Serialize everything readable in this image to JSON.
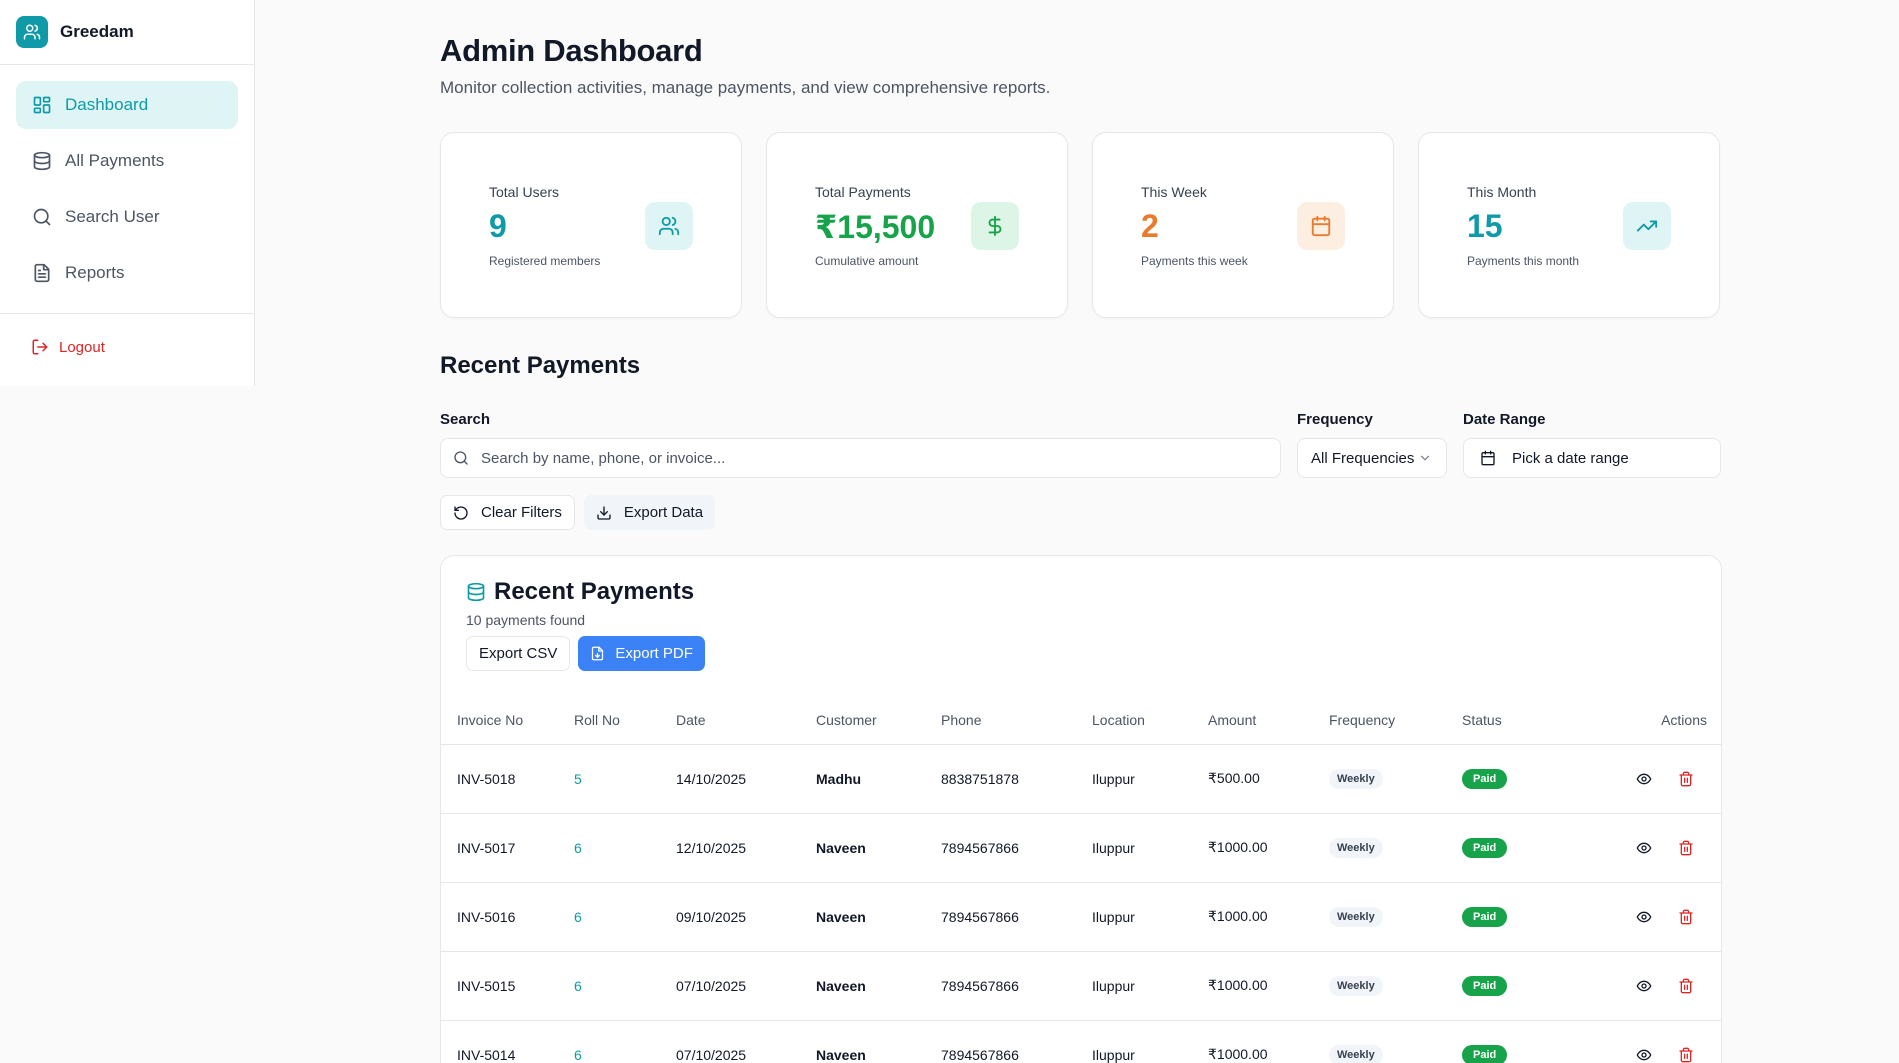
{
  "brand": {
    "name": "Greedam",
    "logo_icon": "users-icon"
  },
  "sidebar": {
    "items": [
      {
        "label": "Dashboard",
        "icon": "layout-dashboard-icon",
        "active": true
      },
      {
        "label": "All Payments",
        "icon": "database-icon",
        "active": false
      },
      {
        "label": "Search User",
        "icon": "search-icon",
        "active": false
      },
      {
        "label": "Reports",
        "icon": "file-text-icon",
        "active": false
      }
    ],
    "logout_label": "Logout"
  },
  "header": {
    "title": "Admin Dashboard",
    "subtitle": "Monitor collection activities, manage payments, and view comprehensive reports."
  },
  "stats": [
    {
      "label": "Total Users",
      "value": "9",
      "desc": "Registered members",
      "color": "#0e9aa7",
      "icon": "users-icon",
      "icon_bg": "#dff5f5"
    },
    {
      "label": "Total Payments",
      "value": "₹15,500",
      "desc": "Cumulative amount",
      "color": "#16a34a",
      "icon": "dollar-icon",
      "icon_bg": "#dcf5e6"
    },
    {
      "label": "This Week",
      "value": "2",
      "desc": "Payments this week",
      "color": "#ea7a2e",
      "icon": "calendar-icon",
      "icon_bg": "#fdeee2"
    },
    {
      "label": "This Month",
      "value": "15",
      "desc": "Payments this month",
      "color": "#0e9aa7",
      "icon": "trending-up-icon",
      "icon_bg": "#dff5f5"
    }
  ],
  "recent_section_title": "Recent Payments",
  "filters": {
    "search_label": "Search",
    "search_placeholder": "Search by name, phone, or invoice...",
    "frequency_label": "Frequency",
    "frequency_value": "All Frequencies",
    "date_label": "Date Range",
    "date_value": "Pick a date range",
    "clear_label": "Clear Filters",
    "export_label": "Export Data"
  },
  "table_card": {
    "title": "Recent Payments",
    "count_text": "10 payments found",
    "export_csv": "Export CSV",
    "export_pdf": "Export PDF",
    "columns": [
      "Invoice No",
      "Roll No",
      "Date",
      "Customer",
      "Phone",
      "Location",
      "Amount",
      "Frequency",
      "Status",
      "Actions"
    ],
    "rows": [
      {
        "invoice": "INV-5018",
        "roll": "5",
        "date": "14/10/2025",
        "customer": "Madhu",
        "phone": "8838751878",
        "location": "Iluppur",
        "amount": "₹500.00",
        "frequency": "Weekly",
        "status": "Paid"
      },
      {
        "invoice": "INV-5017",
        "roll": "6",
        "date": "12/10/2025",
        "customer": "Naveen",
        "phone": "7894567866",
        "location": "Iluppur",
        "amount": "₹1000.00",
        "frequency": "Weekly",
        "status": "Paid"
      },
      {
        "invoice": "INV-5016",
        "roll": "6",
        "date": "09/10/2025",
        "customer": "Naveen",
        "phone": "7894567866",
        "location": "Iluppur",
        "amount": "₹1000.00",
        "frequency": "Weekly",
        "status": "Paid"
      },
      {
        "invoice": "INV-5015",
        "roll": "6",
        "date": "07/10/2025",
        "customer": "Naveen",
        "phone": "7894567866",
        "location": "Iluppur",
        "amount": "₹1000.00",
        "frequency": "Weekly",
        "status": "Paid"
      },
      {
        "invoice": "INV-5014",
        "roll": "6",
        "date": "07/10/2025",
        "customer": "Naveen",
        "phone": "7894567866",
        "location": "Iluppur",
        "amount": "₹1000.00",
        "frequency": "Weekly",
        "status": "Paid"
      }
    ]
  }
}
